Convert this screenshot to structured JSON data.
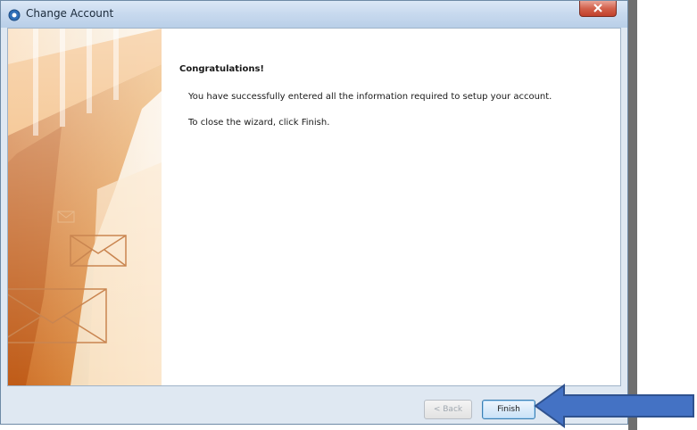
{
  "window": {
    "title": "Change Account"
  },
  "content": {
    "heading": "Congratulations!",
    "line1": "You have successfully entered all the information required to setup your account.",
    "line2": "To close the wizard, click Finish."
  },
  "buttons": {
    "back_label": "< Back",
    "finish_label": "Finish"
  },
  "colors": {
    "arrow": "#4472c4",
    "banner_orange": "#e58a2c"
  },
  "icons": {
    "title": "outlook-icon",
    "close": "close-icon",
    "annotation": "arrow-left-icon"
  }
}
